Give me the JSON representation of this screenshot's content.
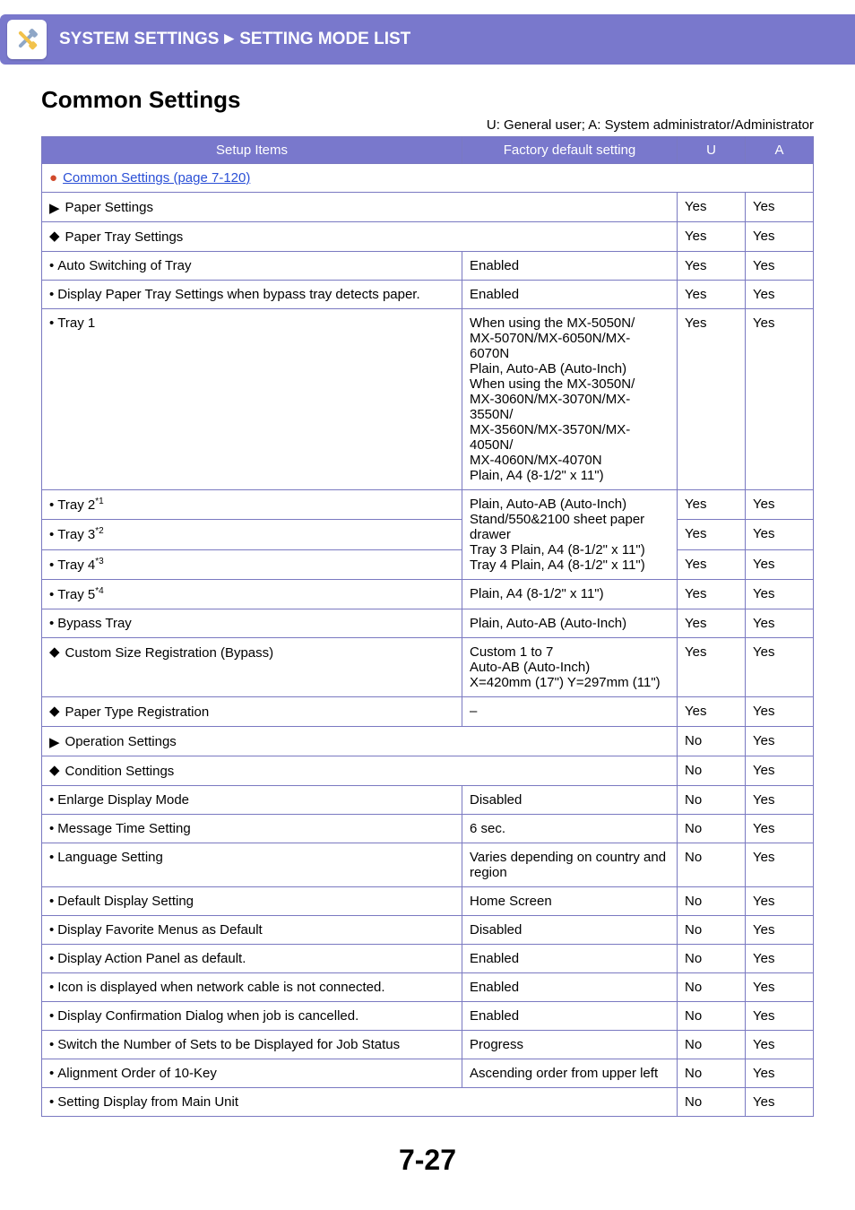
{
  "banner": {
    "left": "SYSTEM SETTINGS",
    "right": "SETTING MODE LIST"
  },
  "section_title": "Common Settings",
  "legend": "U: General user; A: System administrator/Administrator",
  "headers": {
    "setup": "Setup Items",
    "default": "Factory default setting",
    "u": "U",
    "a": "A"
  },
  "top_link": "Common Settings (page 7-120)",
  "rows": {
    "paper_settings": {
      "label": "Paper Settings",
      "u": "Yes",
      "a": "Yes"
    },
    "paper_tray_settings": {
      "label": "Paper Tray Settings",
      "u": "Yes",
      "a": "Yes"
    },
    "auto_switching": {
      "label": "Auto Switching of Tray",
      "default": "Enabled",
      "u": "Yes",
      "a": "Yes"
    },
    "display_paper_tray": {
      "label": "Display Paper Tray Settings when bypass tray detects paper.",
      "default": "Enabled",
      "u": "Yes",
      "a": "Yes"
    },
    "tray1": {
      "label": "Tray 1",
      "default": "When using the MX-5050N/\nMX-5070N/MX-6050N/MX-6070N\nPlain, Auto-AB (Auto-Inch)\nWhen using the MX-3050N/\nMX-3060N/MX-3070N/MX-3550N/\nMX-3560N/MX-3570N/MX-4050N/\nMX-4060N/MX-4070N\nPlain, A4 (8-1/2\" x 11\")",
      "u": "Yes",
      "a": "Yes"
    },
    "tray2": {
      "label": "Tray 2",
      "sup": "*1",
      "u": "Yes",
      "a": "Yes"
    },
    "tray3": {
      "label": "Tray 3",
      "sup": "*2",
      "u": "Yes",
      "a": "Yes"
    },
    "tray4": {
      "label": "Tray 4",
      "sup": "*3",
      "u": "Yes",
      "a": "Yes"
    },
    "tray234_default": "Plain, Auto-AB (Auto-Inch)\nStand/550&2100 sheet paper drawer\nTray 3 Plain, A4 (8-1/2\" x 11\")\nTray 4 Plain, A4 (8-1/2\" x 11\")",
    "tray5": {
      "label": "Tray 5",
      "sup": "*4",
      "default": "Plain, A4 (8-1/2\" x 11\")",
      "u": "Yes",
      "a": "Yes"
    },
    "bypass": {
      "label": "Bypass Tray",
      "default": "Plain, Auto-AB (Auto-Inch)",
      "u": "Yes",
      "a": "Yes"
    },
    "custom_size": {
      "label": "Custom Size Registration (Bypass)",
      "default": "Custom 1 to 7\nAuto-AB (Auto-Inch)\nX=420mm (17\") Y=297mm (11\")",
      "u": "Yes",
      "a": "Yes"
    },
    "paper_type_reg": {
      "label": "Paper Type Registration",
      "default": "–",
      "u": "Yes",
      "a": "Yes"
    },
    "operation": {
      "label": "Operation Settings",
      "u": "No",
      "a": "Yes"
    },
    "condition": {
      "label": "Condition Settings",
      "u": "No",
      "a": "Yes"
    },
    "enlarge": {
      "label": "Enlarge Display Mode",
      "default": "Disabled",
      "u": "No",
      "a": "Yes"
    },
    "msg_time": {
      "label": "Message Time Setting",
      "default": "6 sec.",
      "u": "No",
      "a": "Yes"
    },
    "language": {
      "label": "Language Setting",
      "default": "Varies depending on country and region",
      "u": "No",
      "a": "Yes"
    },
    "default_display": {
      "label": "Default Display Setting",
      "default": "Home Screen",
      "u": "No",
      "a": "Yes"
    },
    "fav_menus": {
      "label": "Display Favorite Menus as Default",
      "default": "Disabled",
      "u": "No",
      "a": "Yes"
    },
    "action_panel": {
      "label": "Display Action Panel as default.",
      "default": "Enabled",
      "u": "No",
      "a": "Yes"
    },
    "network_icon": {
      "label": "Icon is displayed when network cable is not connected.",
      "default": "Enabled",
      "u": "No",
      "a": "Yes"
    },
    "confirm_dialog": {
      "label": "Display Confirmation Dialog when job is cancelled.",
      "default": "Enabled",
      "u": "No",
      "a": "Yes"
    },
    "switch_sets": {
      "label": "Switch the Number of Sets to be Displayed for Job Status",
      "default": "Progress",
      "u": "No",
      "a": "Yes"
    },
    "align_order": {
      "label": "Alignment Order of 10-Key",
      "default": "Ascending order from upper left",
      "u": "No",
      "a": "Yes"
    },
    "setting_display": {
      "label": "Setting Display from Main Unit",
      "u": "No",
      "a": "Yes"
    }
  },
  "page_num": "7-27"
}
